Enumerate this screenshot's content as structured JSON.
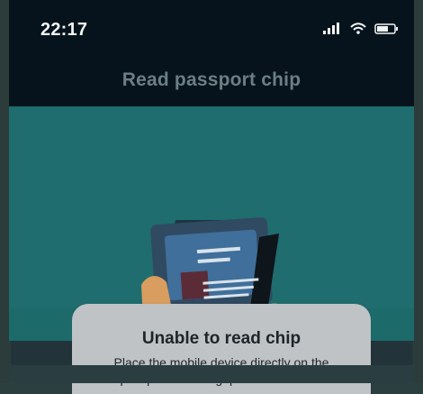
{
  "status": {
    "time": "22:17",
    "icons": [
      "signal-icon",
      "wifi-icon",
      "battery-icon"
    ]
  },
  "header": {
    "title": "Read passport chip"
  },
  "sheet": {
    "title": "Unable to read chip",
    "message": "Place the mobile device directly on the passport with no gap between them."
  },
  "colors": {
    "status_bg": "#07131c",
    "hero_bg": "#1f6d6e",
    "sheet_bg": "#bfc3c5"
  }
}
